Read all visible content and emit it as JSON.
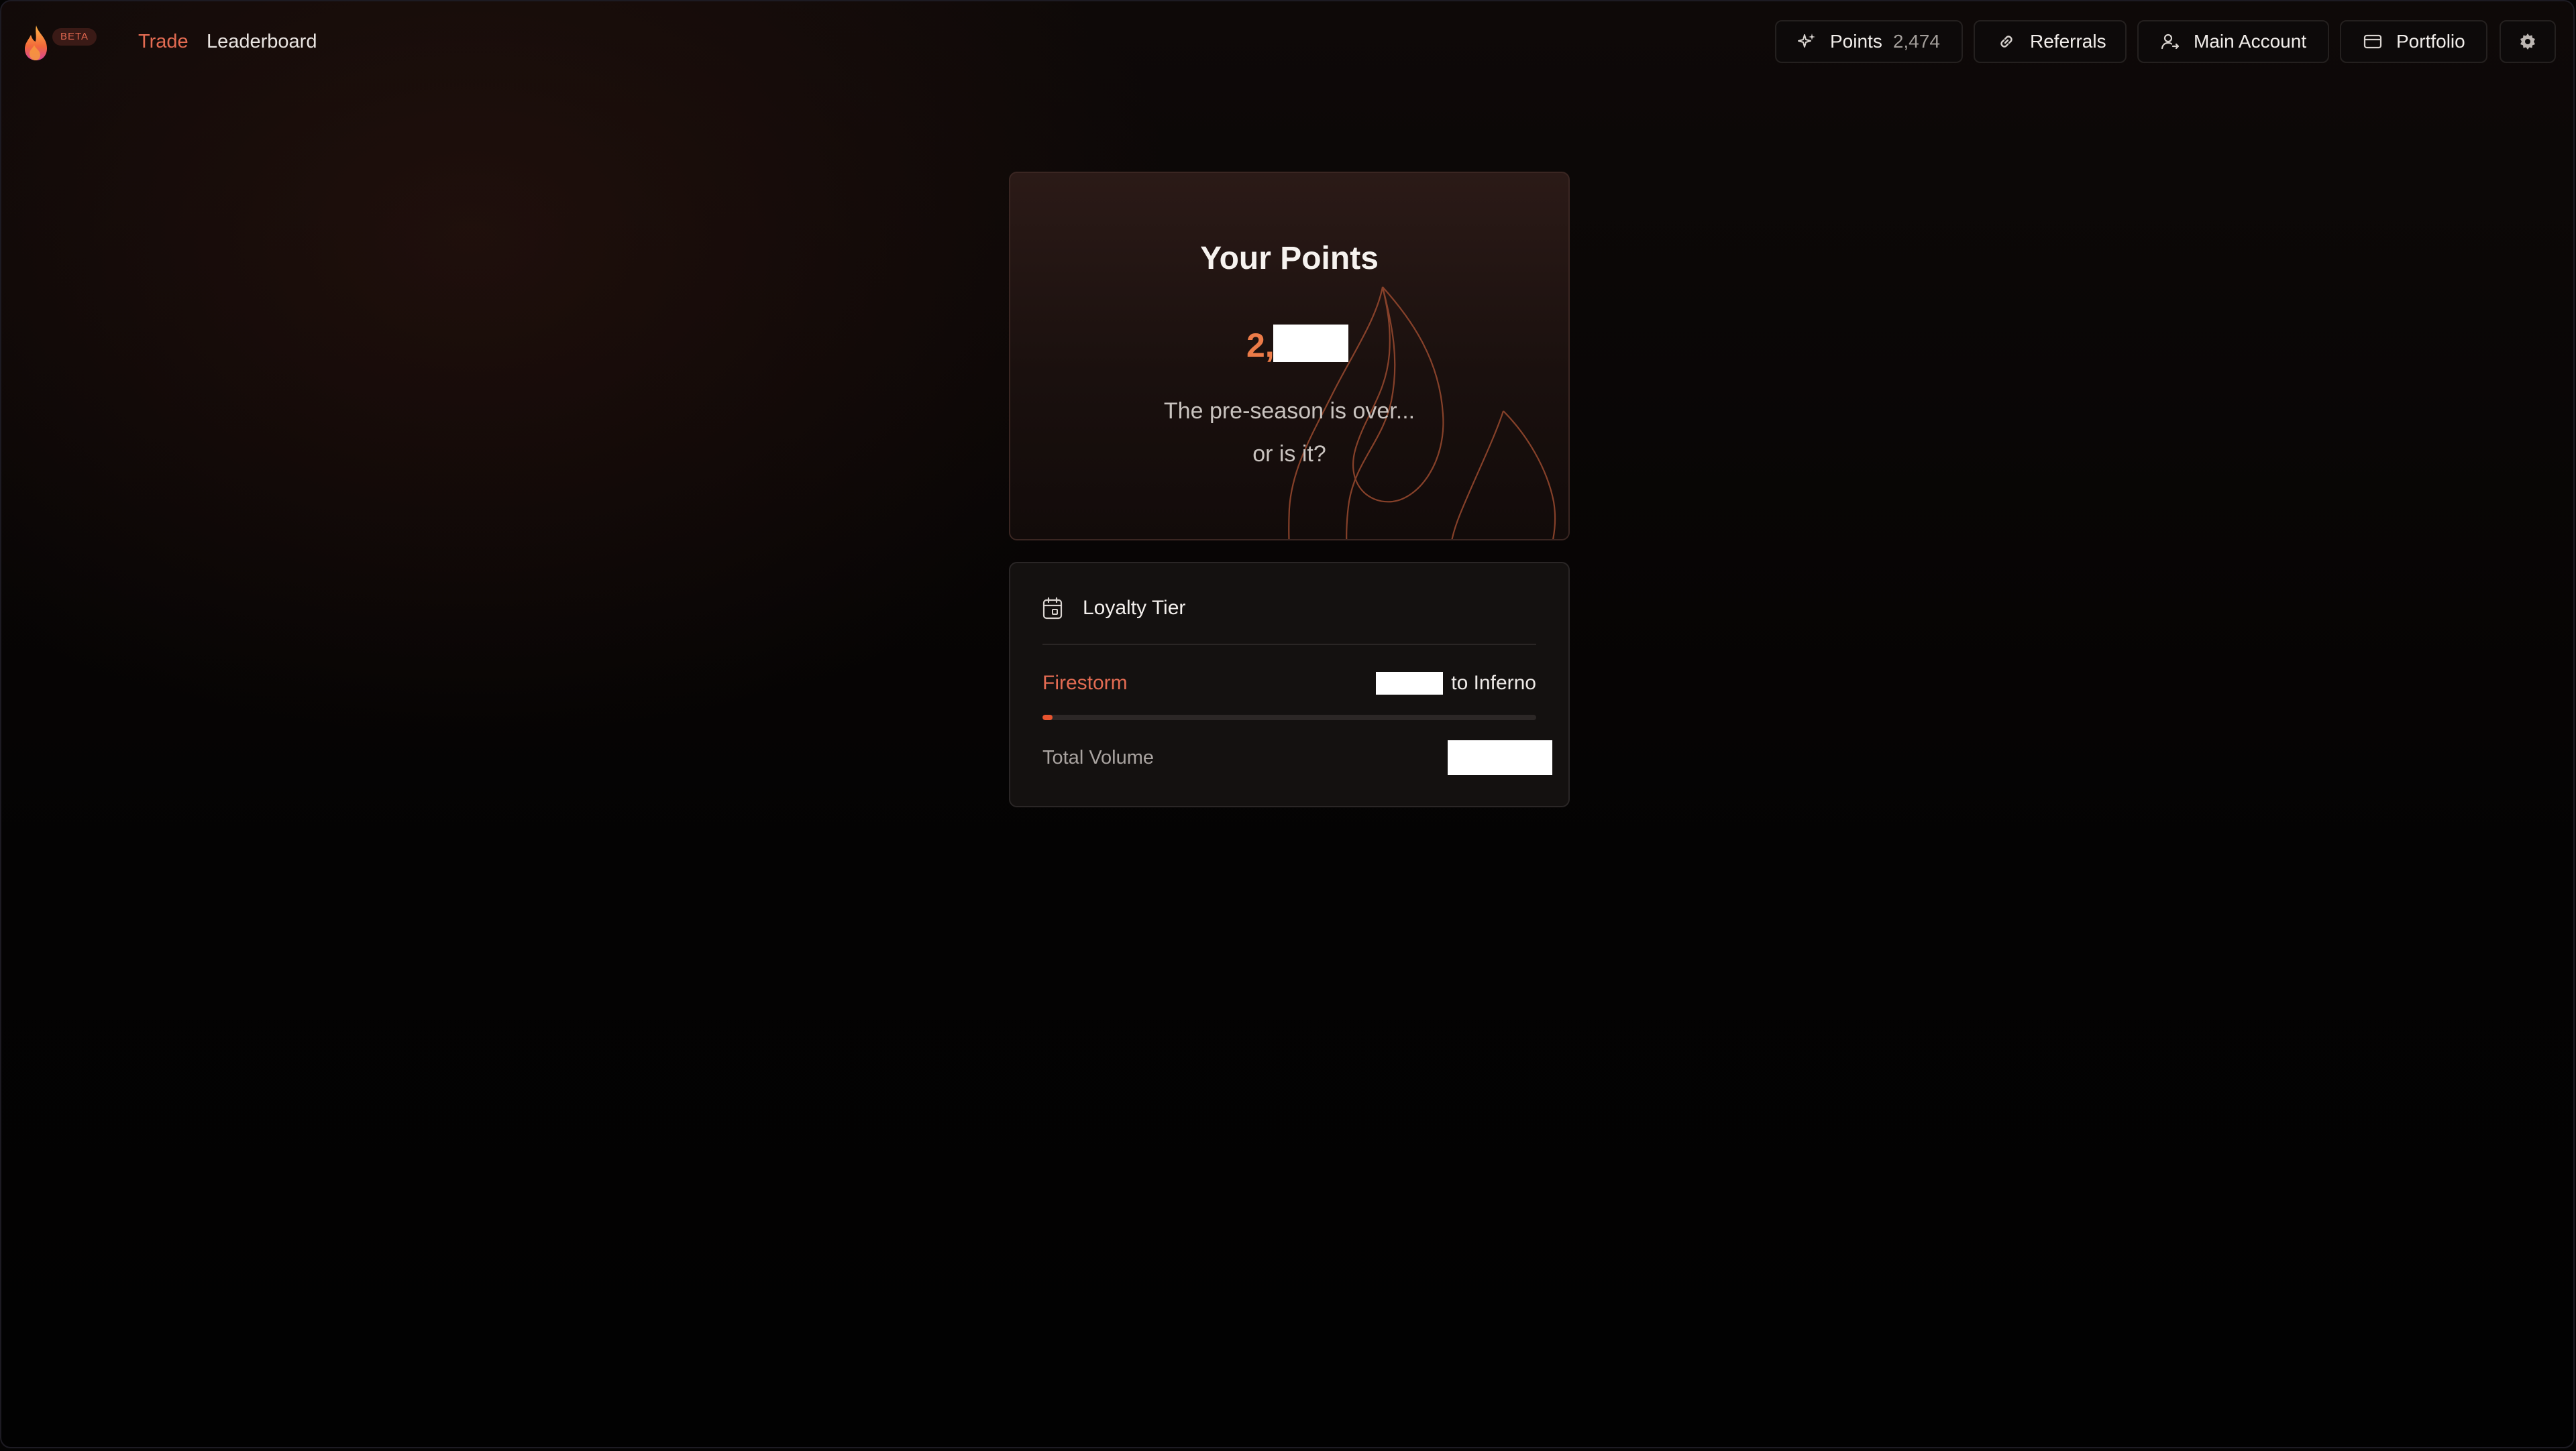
{
  "header": {
    "beta_badge": "BETA",
    "nav": {
      "trade": "Trade",
      "leaderboard": "Leaderboard"
    },
    "buttons": {
      "points_label": "Points",
      "points_value": "2,474",
      "referrals": "Referrals",
      "main_account": "Main Account",
      "portfolio": "Portfolio"
    },
    "icons": [
      "sparkle-icon",
      "link-icon",
      "user-switch-icon",
      "card-icon",
      "gear-icon"
    ]
  },
  "points_card": {
    "title": "Your Points",
    "value_visible": "2,",
    "subtitle_line1": "The pre-season is over...",
    "subtitle_line2": "or is it?"
  },
  "loyalty": {
    "title": "Loyalty Tier",
    "current_tier": "Firestorm",
    "next_tier_text": "to Inferno",
    "progress_fraction": 0.02,
    "total_volume_label": "Total Volume"
  },
  "colors": {
    "accent": "#e36b52",
    "points_orange": "#ec7b48",
    "progress": "#e8542f",
    "background": "#050404"
  }
}
